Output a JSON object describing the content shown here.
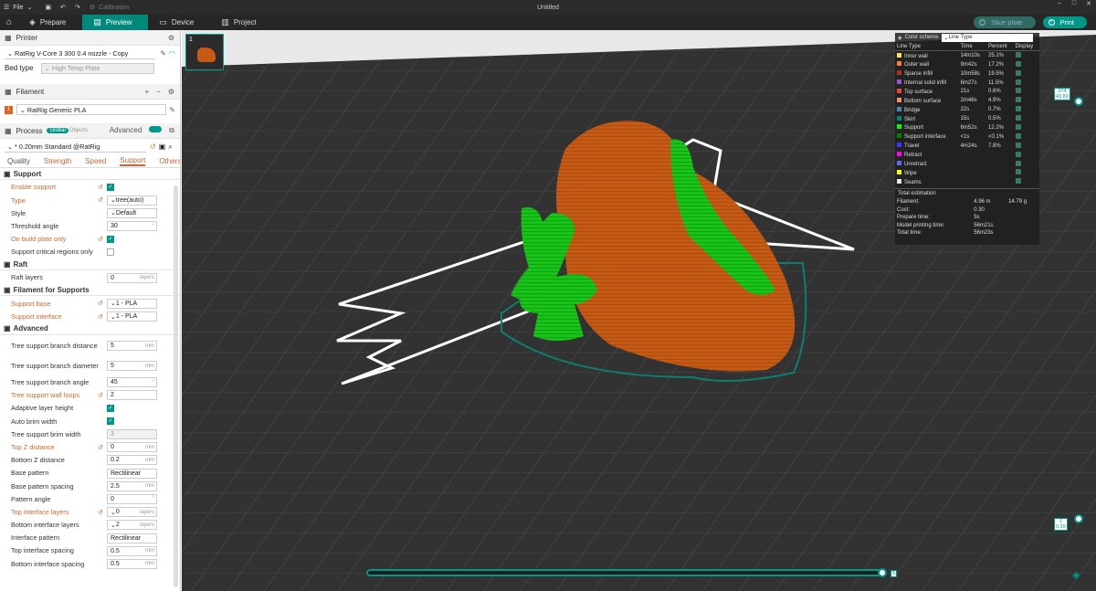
{
  "titlebar": {
    "file": "File",
    "calibration": "Calibration",
    "title": "Untitled"
  },
  "tabs": {
    "prepare": "Prepare",
    "preview": "Preview",
    "device": "Device",
    "project": "Project"
  },
  "actions": {
    "slice": "Slice plate",
    "print": "Print"
  },
  "printer": {
    "section": "Printer",
    "name": "RatRig V-Core 3 300 0.4 nozzle - Copy",
    "bed_label": "Bed type",
    "bed": "High Temp Plate"
  },
  "filament": {
    "section": "Filament",
    "item_no": "1",
    "name": "RatRig Generic PLA"
  },
  "process": {
    "section": "Process",
    "global": "Global",
    "objects": "Objects",
    "advanced": "Advanced",
    "profile": "* 0.20mm Standard @RatRig"
  },
  "subtabs": [
    "Quality",
    "Strength",
    "Speed",
    "Support",
    "Others"
  ],
  "settings": {
    "support_hdr": "Support",
    "enable_support": "Enable support",
    "type": "Type",
    "type_val": "tree(auto)",
    "style": "Style",
    "style_val": "Default",
    "threshold": "Threshold angle",
    "threshold_val": "30",
    "build_plate": "On build plate only",
    "critical": "Support critical regions only",
    "raft_hdr": "Raft",
    "raft_layers": "Raft layers",
    "raft_layers_val": "0",
    "raft_unit": "layers",
    "fil_hdr": "Filament for Supports",
    "sup_base": "Support base",
    "sup_base_val": "1 - PLA",
    "sup_iface": "Support interface",
    "sup_iface_val": "1 - PLA",
    "adv_hdr": "Advanced",
    "branch_dist": "Tree support branch distance",
    "branch_dist_val": "5",
    "branch_diam": "Tree support branch diameter",
    "branch_diam_val": "5",
    "branch_angle": "Tree support branch angle",
    "branch_angle_val": "45",
    "wall_loops": "Tree support wall loops",
    "wall_loops_val": "2",
    "adaptive": "Adaptive layer height",
    "auto_brim": "Auto brim width",
    "brim_width": "Tree support brim width",
    "brim_width_val": "3",
    "top_z": "Top Z distance",
    "top_z_val": "0",
    "bot_z": "Bottom Z distance",
    "bot_z_val": "0.2",
    "base_pattern": "Base pattern",
    "base_pattern_val": "Rectilinear",
    "base_spacing": "Base pattern spacing",
    "base_spacing_val": "2.5",
    "pattern_angle": "Pattern angle",
    "pattern_angle_val": "0",
    "top_if_layers": "Top interface layers",
    "top_if_layers_val": "0",
    "bot_if_layers": "Bottom interface layers",
    "bot_if_layers_val": "2",
    "if_pattern": "Interface pattern",
    "if_pattern_val": "Rectilinear",
    "top_if_spacing": "Top interface spacing",
    "top_if_spacing_val": "0.5",
    "bot_if_spacing": "Bottom interface spacing",
    "bot_if_spacing_val": "0.5",
    "mm": "mm",
    "layers": "layers"
  },
  "plate": {
    "number": "1"
  },
  "legend": {
    "scheme_label": "Color scheme",
    "scheme": "Line Type",
    "headers": [
      "Line Type",
      "Time",
      "Percent",
      "Display"
    ],
    "rows": [
      {
        "name": "Inner wall",
        "time": "14m10s",
        "pct": "25.1%",
        "color": "#ffe64d"
      },
      {
        "name": "Outer wall",
        "time": "9m42s",
        "pct": "17.2%",
        "color": "#ff7d38"
      },
      {
        "name": "Sparse infill",
        "time": "10m58s",
        "pct": "19.5%",
        "color": "#b03029"
      },
      {
        "name": "Internal solid infill",
        "time": "6m27s",
        "pct": "11.5%",
        "color": "#9654cc"
      },
      {
        "name": "Top surface",
        "time": "21s",
        "pct": "0.6%",
        "color": "#f04040"
      },
      {
        "name": "Bottom surface",
        "time": "2m46s",
        "pct": "4.9%",
        "color": "#ff8c69"
      },
      {
        "name": "Bridge",
        "time": "22s",
        "pct": "0.7%",
        "color": "#4d80ba"
      },
      {
        "name": "Skirt",
        "time": "15s",
        "pct": "0.5%",
        "color": "#00876e"
      },
      {
        "name": "Support",
        "time": "6m52s",
        "pct": "12.2%",
        "color": "#00ff00"
      },
      {
        "name": "Support interface",
        "time": "<1s",
        "pct": "<0.1%",
        "color": "#008000"
      },
      {
        "name": "Travel",
        "time": "4m24s",
        "pct": "7.8%",
        "color": "#3838ff"
      },
      {
        "name": "Retract",
        "time": "",
        "pct": "",
        "color": "#ff00ff"
      },
      {
        "name": "Unretract",
        "time": "",
        "pct": "",
        "color": "#5a66ff"
      },
      {
        "name": "Wipe",
        "time": "",
        "pct": "",
        "color": "#ffff00"
      },
      {
        "name": "Seams",
        "time": "",
        "pct": "",
        "color": "#e6e6e6"
      }
    ],
    "total_label": "Total estimation",
    "estimates": [
      {
        "k": "Filament:",
        "v": "4.96 m",
        "v2": "14.79 g"
      },
      {
        "k": "Cost:",
        "v": "0.30",
        "v2": ""
      },
      {
        "k": "Prepare time:",
        "v": "5s",
        "v2": ""
      },
      {
        "k": "Model printing time:",
        "v": "56m21s",
        "v2": ""
      },
      {
        "k": "Total time:",
        "v": "56m23s",
        "v2": ""
      }
    ]
  },
  "vslider": {
    "top": "374",
    "top_h": "43.80",
    "bottom": "1",
    "bottom_h": "0.20"
  },
  "hslider": {
    "end": "5"
  }
}
